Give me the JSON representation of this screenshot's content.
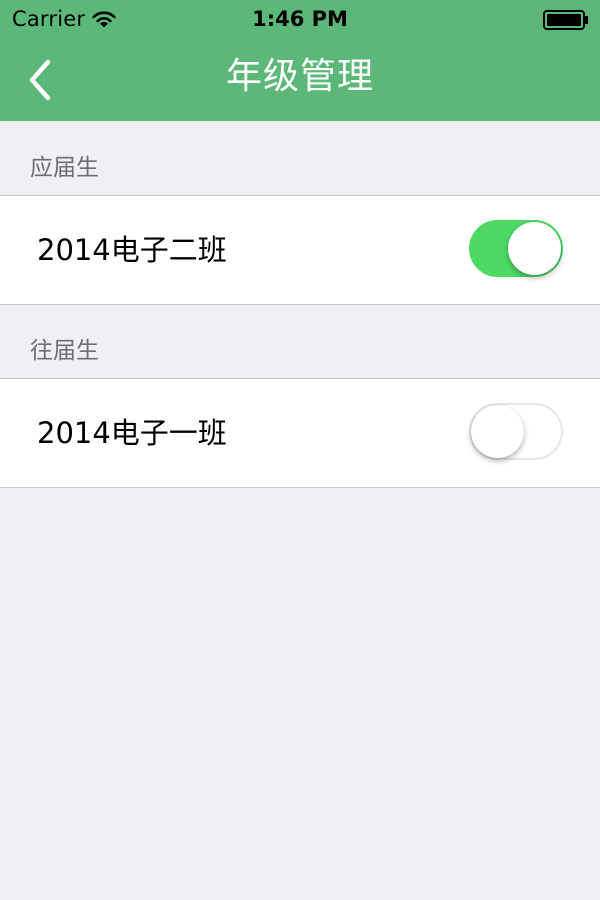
{
  "status_bar": {
    "carrier": "Carrier",
    "time": "1:46 PM"
  },
  "nav": {
    "title": "年级管理",
    "back_icon": "chevron-left-icon"
  },
  "sections": [
    {
      "header": "应届生",
      "items": [
        {
          "label": "2014电子二班",
          "enabled": true
        }
      ]
    },
    {
      "header": "往届生",
      "items": [
        {
          "label": "2014电子一班",
          "enabled": false
        }
      ]
    }
  ],
  "colors": {
    "nav_bar": "#5cb879",
    "background": "#efeff4",
    "switch_on": "#4cd964",
    "section_header_text": "#6d6d72"
  }
}
